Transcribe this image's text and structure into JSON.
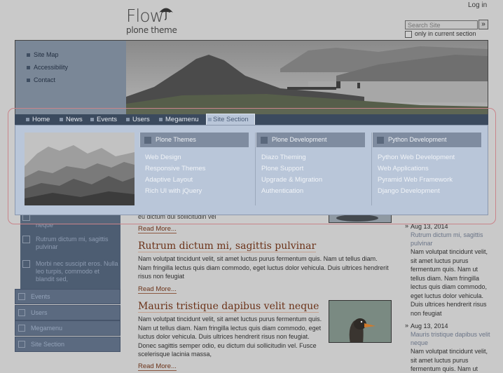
{
  "header": {
    "logo_title": "Flow",
    "logo_subtitle": "plone theme",
    "login_label": "Log in",
    "search_placeholder": "Search Site",
    "search_button": "»",
    "search_scope_label": "only in current section"
  },
  "site_actions": [
    "Site Map",
    "Accessibility",
    "Contact"
  ],
  "megamenu": {
    "tabs": [
      {
        "label": "Home"
      },
      {
        "label": "News"
      },
      {
        "label": "Events"
      },
      {
        "label": "Users"
      },
      {
        "label": "Megamenu"
      },
      {
        "label": "Site Section"
      }
    ],
    "active_tab": "Site Section",
    "columns": [
      {
        "title": "Plone Themes",
        "links": [
          "Web Design",
          "Responsive Themes",
          "Adaptive Layout",
          "Rich UI with jQuery"
        ]
      },
      {
        "title": "Plone Development",
        "links": [
          "Diazo Theming",
          "Plone Support",
          "Upgrade & Migration",
          "Authentication"
        ]
      },
      {
        "title": "Python Development",
        "links": [
          "Python Web Development",
          "Web Applications",
          "Pyramid Web Framework",
          "Django Development"
        ]
      }
    ]
  },
  "left_nav": {
    "sub_items": [
      {
        "text": "neque"
      },
      {
        "text": "Rutrum dictum mi, sagittis pulvinar"
      },
      {
        "text": "Morbi nec suscipit eros. Nulla leo turpis, commodo et blandit sed,"
      }
    ],
    "items": [
      {
        "label": "Events"
      },
      {
        "label": "Users"
      },
      {
        "label": "Megamenu"
      },
      {
        "label": "Site Section"
      }
    ]
  },
  "articles": [
    {
      "partial_text": "eu dictum dui sollicitudin vel",
      "read_more": "Read More..."
    },
    {
      "title": "Rutrum dictum mi, sagittis pulvinar",
      "body": "Nam volutpat tincidunt velit, sit amet luctus purus fermentum quis. Nam ut tellus diam. Nam fringilla lectus quis diam commodo, eget luctus dolor vehicula. Duis ultrices hendrerit risus non feugiat",
      "read_more": "Read More..."
    },
    {
      "title": "Mauris tristique dapibus velit neque",
      "body": "Nam volutpat tincidunt velit, sit amet luctus purus fermentum quis. Nam ut tellus diam. Nam fringilla lectus quis diam commodo, eget luctus dolor vehicula. Duis ultrices hendrerit risus non feugiat. Donec sagittis semper odio, eu dictum dui sollicitudin vel. Fusce scelerisque lacinia massa,",
      "read_more": "Read More..."
    }
  ],
  "news_sidebar": [
    {
      "date": "Aug 13, 2014",
      "title": "Rutrum dictum mi, sagittis pulvinar",
      "text": "Nam volutpat tincidunt velit, sit amet luctus purus fermentum quis. Nam ut tellus diam. Nam fringilla lectus quis diam commodo, eget luctus dolor vehicula. Duis ultrices hendrerit risus non feugiat"
    },
    {
      "date": "Aug 13, 2014",
      "title": "Mauris tristique dapibus velit neque",
      "text": "Nam volutpat tincidunt velit, sit amet luctus purus fermentum quis. Nam ut"
    }
  ],
  "colors": {
    "nav_bar": "#3b4a5e",
    "menu_panel": "#b9c6d9",
    "title_link": "#6b3218",
    "overlay_outline": "#c9848a"
  }
}
